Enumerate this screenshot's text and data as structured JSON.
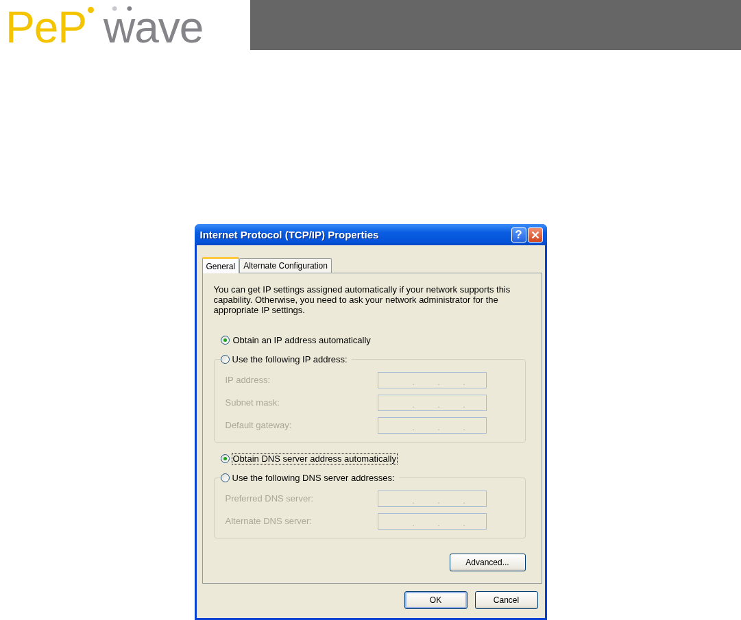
{
  "header": {
    "logo": [
      "PeP",
      "wave"
    ]
  },
  "dialog": {
    "title": "Internet Protocol (TCP/IP) Properties",
    "help": "?",
    "tabs": [
      {
        "label": "General",
        "selected": true
      },
      {
        "label": "Alternate Configuration",
        "selected": false
      }
    ],
    "intro": "You can get IP settings assigned automatically if your network supports this capability. Otherwise, you need to ask your network administrator for the appropriate IP settings.",
    "groups": [
      {
        "auto": {
          "label": "Obtain an IP address automatically",
          "selected": true,
          "focused": false
        },
        "manual": {
          "label": "Use the following IP address:",
          "selected": false
        },
        "disabled": true,
        "fields": [
          {
            "label": "IP address:",
            "separators": [
              ".",
              ".",
              "."
            ]
          },
          {
            "label": "Subnet mask:",
            "separators": [
              ".",
              ".",
              "."
            ]
          },
          {
            "label": "Default gateway:",
            "separators": [
              ".",
              ".",
              "."
            ]
          }
        ]
      },
      {
        "auto": {
          "label": "Obtain DNS server address automatically",
          "selected": true,
          "focused": true
        },
        "manual": {
          "label": "Use the following DNS server addresses:",
          "selected": false
        },
        "disabled": true,
        "fields": [
          {
            "label": "Preferred DNS server:",
            "separators": [
              ".",
              ".",
              "."
            ]
          },
          {
            "label": "Alternate DNS server:",
            "separators": [
              ".",
              ".",
              "."
            ]
          }
        ]
      }
    ],
    "advanced": "Advanced...",
    "buttons": [
      {
        "label": "OK",
        "default": true
      },
      {
        "label": "Cancel",
        "default": false
      }
    ]
  }
}
